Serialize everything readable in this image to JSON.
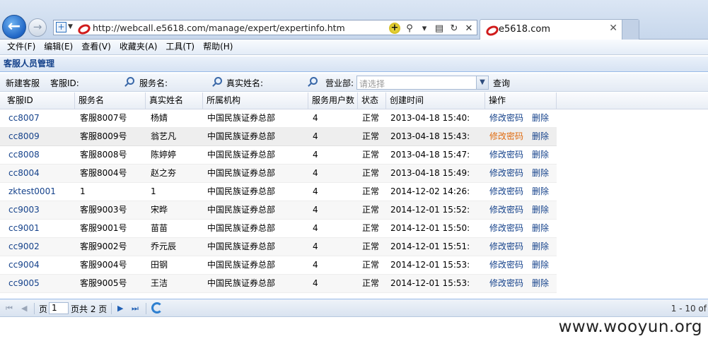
{
  "browser": {
    "url": "http://webcall.e5618.com/manage/expert/expertinfo.htm",
    "tab_title": "e5618.com"
  },
  "menu": [
    "文件(F)",
    "编辑(E)",
    "查看(V)",
    "收藏夹(A)",
    "工具(T)",
    "帮助(H)"
  ],
  "panel": {
    "title": "客服人员管理"
  },
  "toolbar": {
    "new_label": "新建客服",
    "id_label": "客服ID:",
    "service_name_label": "服务名:",
    "real_name_label": "真实姓名:",
    "dept_label": "营业部:",
    "dept_placeholder": "请选择",
    "query_label": "查询"
  },
  "grid": {
    "columns": [
      "客服ID",
      "服务名",
      "真实姓名",
      "所属机构",
      "服务用户数",
      "状态",
      "创建时间",
      "操作"
    ],
    "action_change_pwd": "修改密码",
    "action_delete": "删除",
    "rows": [
      {
        "id": "cc8007",
        "service": "客服8007号",
        "real": "杨婧",
        "org": "中国民族证券总部",
        "users": "4",
        "status": "正常",
        "created": "2013-04-18 15:40:"
      },
      {
        "id": "cc8009",
        "service": "客服8009号",
        "real": "翁艺凡",
        "org": "中国民族证券总部",
        "users": "4",
        "status": "正常",
        "created": "2013-04-18 15:43:"
      },
      {
        "id": "cc8008",
        "service": "客服8008号",
        "real": "陈婷婷",
        "org": "中国民族证券总部",
        "users": "4",
        "status": "正常",
        "created": "2013-04-18 15:47:"
      },
      {
        "id": "cc8004",
        "service": "客服8004号",
        "real": "赵之夯",
        "org": "中国民族证券总部",
        "users": "4",
        "status": "正常",
        "created": "2013-04-18 15:49:"
      },
      {
        "id": "zktest0001",
        "service": "1",
        "real": "1",
        "org": "中国民族证券总部",
        "users": "4",
        "status": "正常",
        "created": "2014-12-02 14:26:"
      },
      {
        "id": "cc9003",
        "service": "客服9003号",
        "real": "宋晔",
        "org": "中国民族证券总部",
        "users": "4",
        "status": "正常",
        "created": "2014-12-01 15:52:"
      },
      {
        "id": "cc9001",
        "service": "客服9001号",
        "real": "苗苗",
        "org": "中国民族证券总部",
        "users": "4",
        "status": "正常",
        "created": "2014-12-01 15:50:"
      },
      {
        "id": "cc9002",
        "service": "客服9002号",
        "real": "乔元辰",
        "org": "中国民族证券总部",
        "users": "4",
        "status": "正常",
        "created": "2014-12-01 15:51:"
      },
      {
        "id": "cc9004",
        "service": "客服9004号",
        "real": "田钢",
        "org": "中国民族证券总部",
        "users": "4",
        "status": "正常",
        "created": "2014-12-01 15:53:"
      },
      {
        "id": "cc9005",
        "service": "客服9005号",
        "real": "王洁",
        "org": "中国民族证券总部",
        "users": "4",
        "status": "正常",
        "created": "2014-12-01 15:53:"
      }
    ]
  },
  "pager": {
    "page_label": "页",
    "page_value": "1",
    "total_label": "页共 2 页",
    "info": "1 - 10 of"
  },
  "watermark": "www.wooyun.org"
}
